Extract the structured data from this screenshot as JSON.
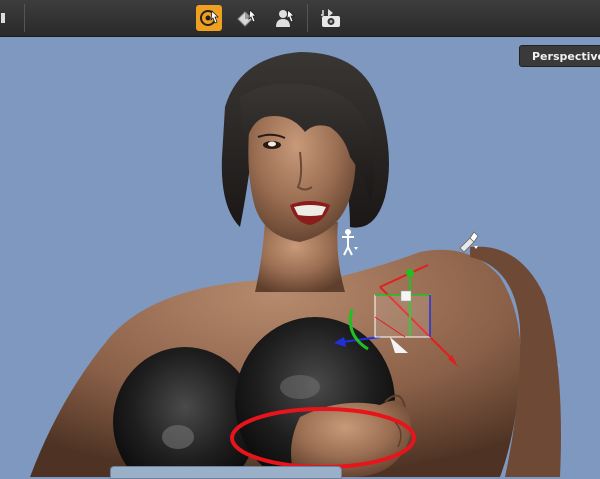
{
  "toolbar": {
    "icons": [
      "toolbar-edge-icon",
      "universal-tool-icon",
      "surface-selection-icon",
      "node-selection-icon",
      "render-icon"
    ],
    "active_tool": "universal-tool",
    "accent_color": "#f0a020"
  },
  "viewport": {
    "camera_label": "Perspective",
    "background_color": "#7f98c0",
    "annotation_color": "#e8141c"
  }
}
